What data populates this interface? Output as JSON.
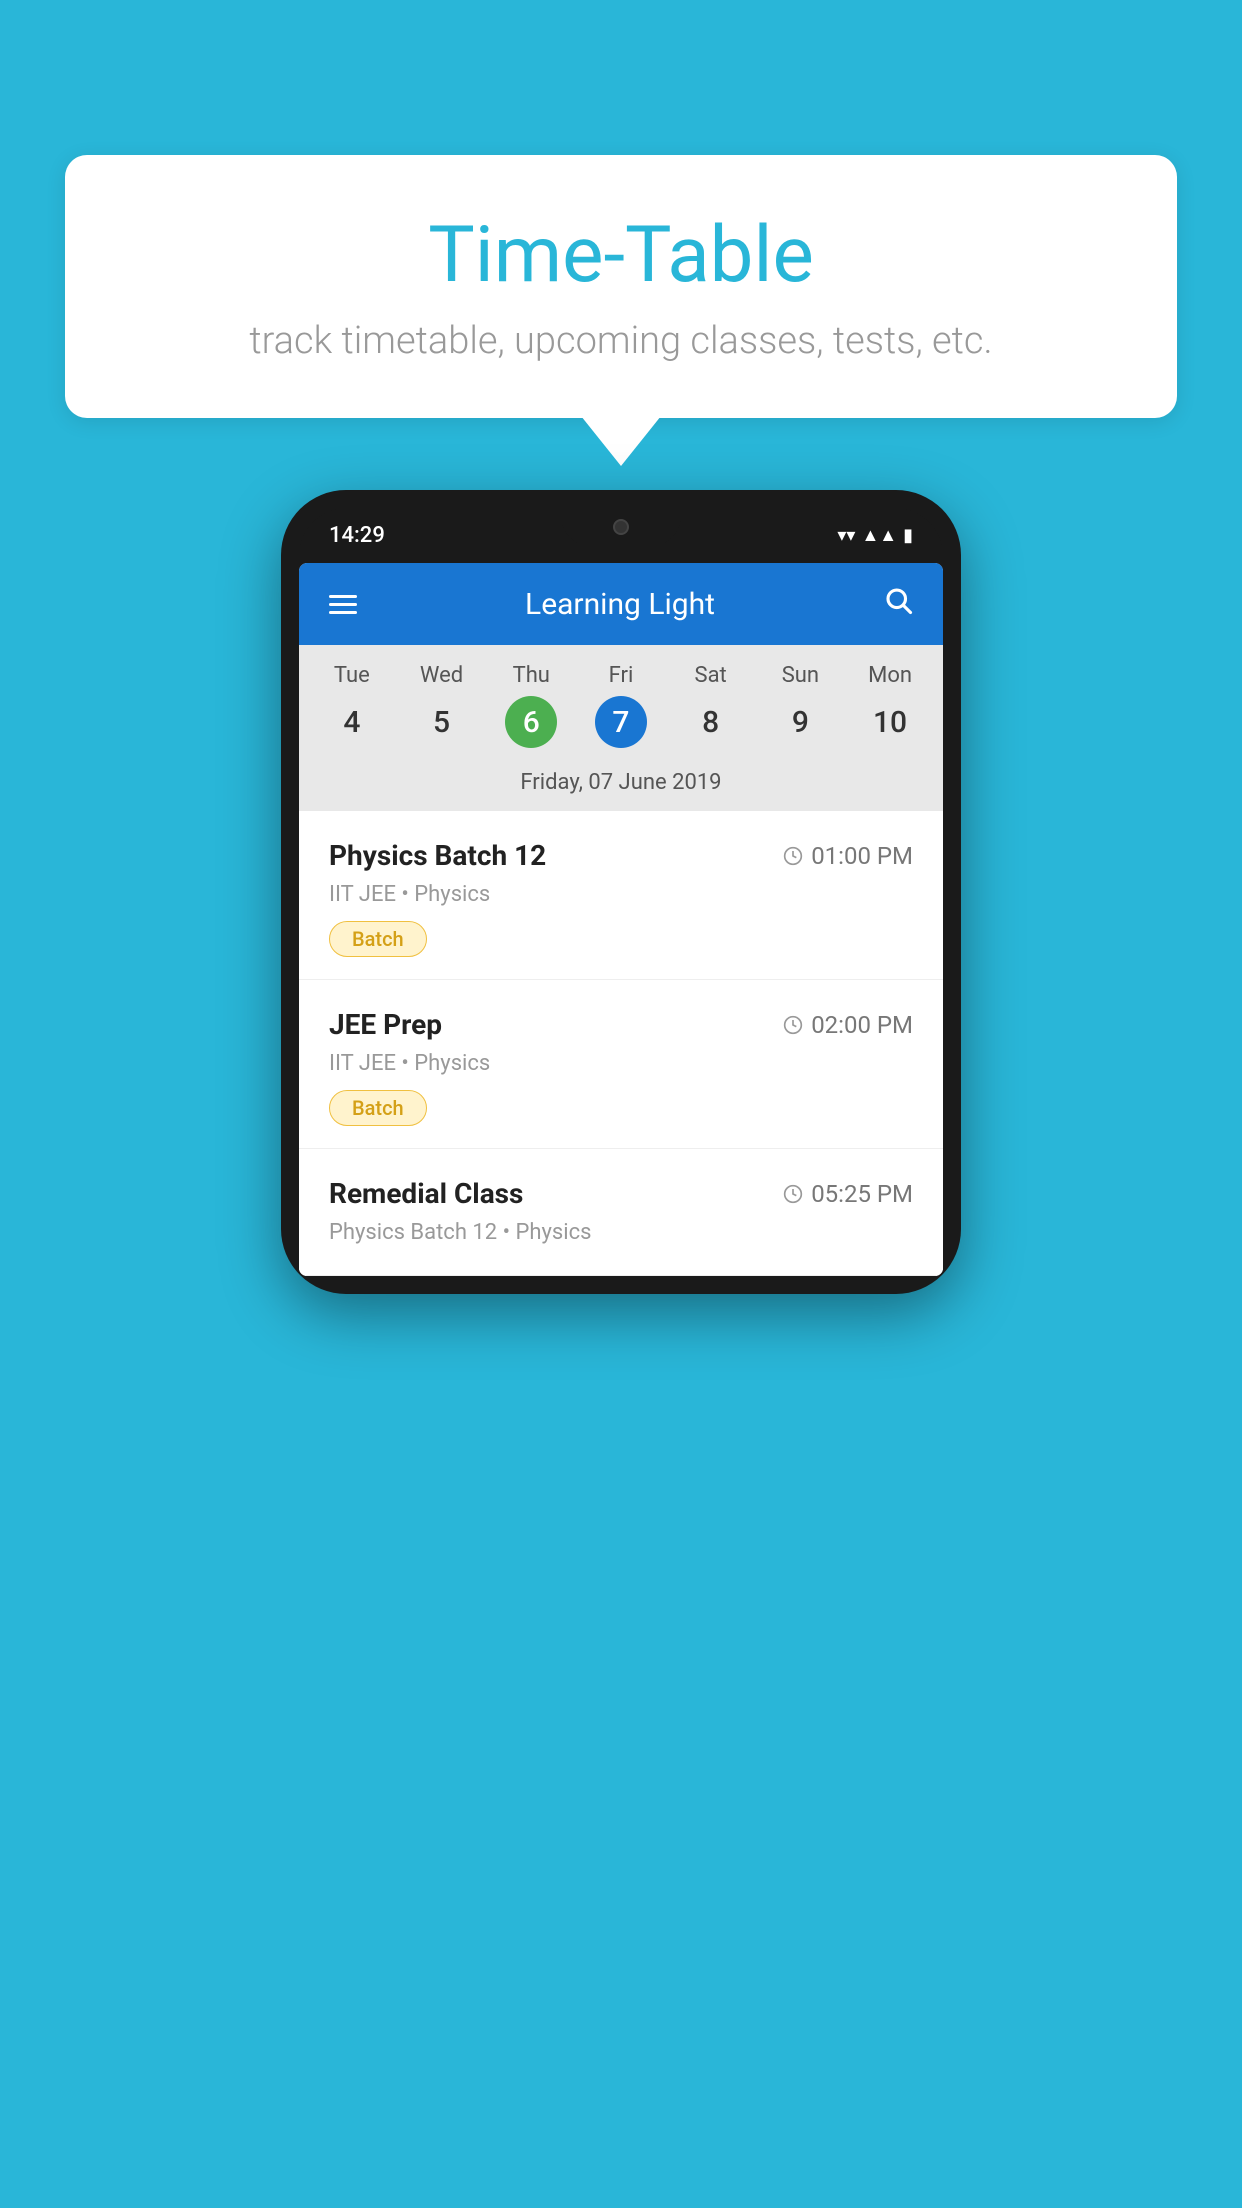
{
  "background": {
    "color": "#29B6D8"
  },
  "bubble": {
    "title": "Time-Table",
    "subtitle": "track timetable, upcoming classes, tests, etc."
  },
  "phone": {
    "status_bar": {
      "time": "14:29"
    },
    "header": {
      "title": "Learning Light"
    },
    "calendar": {
      "days": [
        {
          "name": "Tue",
          "num": "4",
          "state": "normal"
        },
        {
          "name": "Wed",
          "num": "5",
          "state": "normal"
        },
        {
          "name": "Thu",
          "num": "6",
          "state": "today"
        },
        {
          "name": "Fri",
          "num": "7",
          "state": "selected"
        },
        {
          "name": "Sat",
          "num": "8",
          "state": "normal"
        },
        {
          "name": "Sun",
          "num": "9",
          "state": "normal"
        },
        {
          "name": "Mon",
          "num": "10",
          "state": "normal"
        }
      ],
      "selected_date_label": "Friday, 07 June 2019"
    },
    "schedule": [
      {
        "title": "Physics Batch 12",
        "time": "01:00 PM",
        "subtitle": "IIT JEE • Physics",
        "tag": "Batch"
      },
      {
        "title": "JEE Prep",
        "time": "02:00 PM",
        "subtitle": "IIT JEE • Physics",
        "tag": "Batch"
      },
      {
        "title": "Remedial Class",
        "time": "05:25 PM",
        "subtitle": "Physics Batch 12 • Physics",
        "tag": null,
        "partial": true
      }
    ]
  },
  "icons": {
    "hamburger": "≡",
    "search": "🔍",
    "clock": "🕐"
  }
}
